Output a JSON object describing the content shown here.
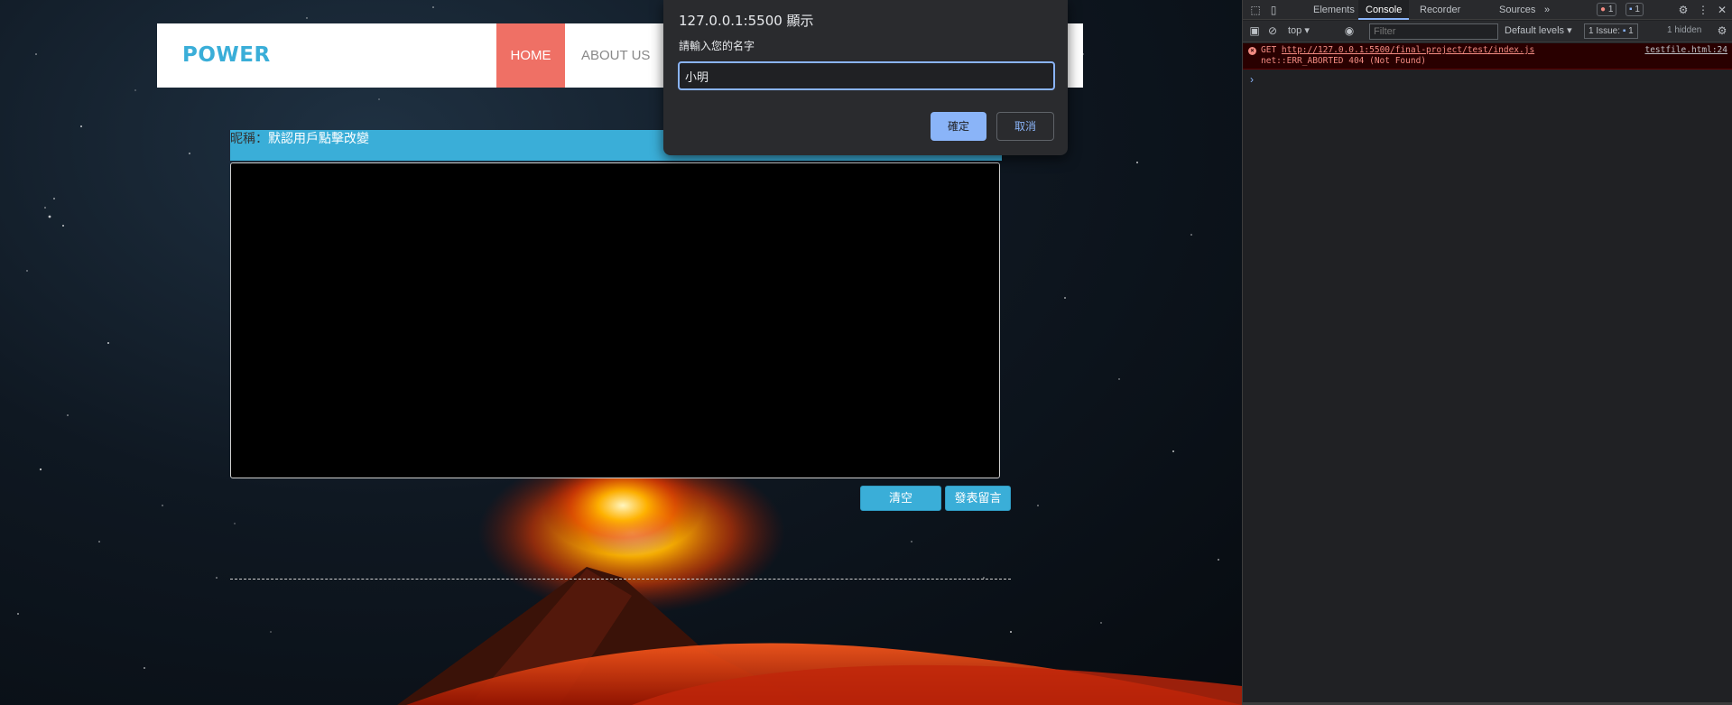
{
  "page": {
    "brand": "POWER",
    "nav": [
      {
        "label": "HOME",
        "active": true
      },
      {
        "label": "ABOUT US",
        "active": false
      }
    ],
    "nickname_label": "昵稱：",
    "nickname_value": "默認用戶點擊改變",
    "buttons": {
      "clear": "清空",
      "post": "發表留言"
    },
    "colors": {
      "accent": "#3aaed8",
      "nav_active": "#ef7065"
    }
  },
  "dialog": {
    "title": "127.0.0.1:5500 顯示",
    "message": "請輸入您的名字",
    "input_value": "小明",
    "ok": "確定",
    "cancel": "取消"
  },
  "devtools": {
    "tabs": [
      "Elements",
      "Console",
      "Recorder",
      "Sources"
    ],
    "active_tab": "Console",
    "more_tabs": "»",
    "error_count": "1",
    "message_count": "1",
    "context": "top",
    "filter_placeholder": "Filter",
    "levels": "Default levels",
    "issues_label": "1 Issue:",
    "issues_count": "1",
    "hidden": "1 hidden",
    "error": {
      "method": "GET",
      "url": "http://127.0.0.1:5500/final-project/test/index.js",
      "detail": "net::ERR_ABORTED 404 (Not Found)",
      "source": "testfile.html:24"
    },
    "prompt": "›"
  }
}
